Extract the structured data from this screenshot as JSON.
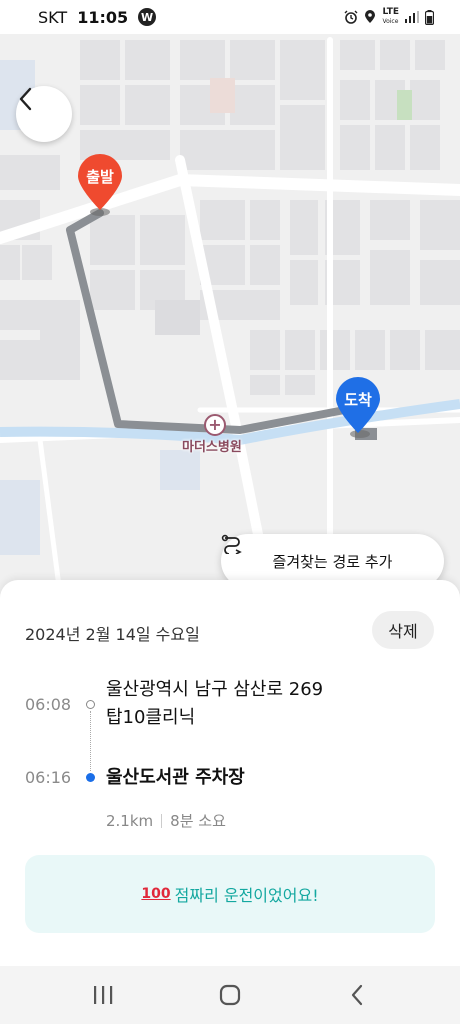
{
  "status_bar": {
    "carrier": "SKT",
    "time": "11:05",
    "app_badge": "W",
    "lte_top": "LTE",
    "volte": "Voice"
  },
  "map": {
    "origin_label": "출발",
    "destination_label": "도착",
    "poi_name": "마더스병원",
    "origin_color": "#ef4a2f",
    "destination_color": "#1f6fe6",
    "route_color": "#8c8f94",
    "river_color": "#cfe6f6"
  },
  "favorite_button": {
    "label": "즐겨찾는 경로 추가",
    "icon": "route-swap-icon"
  },
  "trip": {
    "date": "2024년 2월 14일 수요일",
    "delete_label": "삭제",
    "origin": {
      "time": "06:08",
      "address_line1": "울산광역시 남구 삼산로 269",
      "address_line2": "탑10클리닉"
    },
    "destination": {
      "time": "06:16",
      "name": "울산도서관 주차장"
    },
    "distance": "2.1km",
    "duration": "8분 소요",
    "score_emoji": "100",
    "score_message": "점짜리 운전이었어요!"
  },
  "nav_bar": {
    "recent_icon": "recent-apps-icon",
    "home_icon": "home-icon",
    "back_icon": "back-icon"
  }
}
